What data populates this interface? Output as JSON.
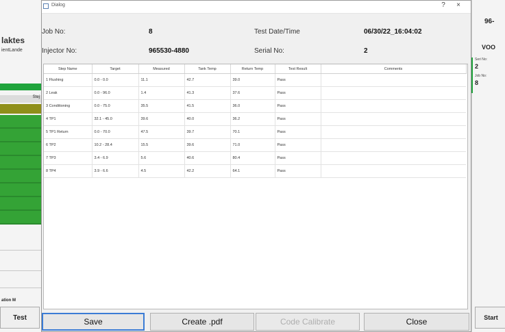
{
  "background_left": {
    "title": "laktes",
    "subtitle": "ientLande",
    "header_cell": "Stej",
    "status_label": "ation M",
    "test_button": "Test"
  },
  "background_right": {
    "number": "96-",
    "voo_label": "VOO",
    "field1_label": "Seri No:",
    "field1_value": "2",
    "field2_label": "Job No:",
    "field2_value": "8",
    "start_button": "Start"
  },
  "dialog": {
    "window_title": "Dialog",
    "job_no_label": "Job No:",
    "job_no_value": "8",
    "test_datetime_label": "Test Date/Time",
    "test_datetime_value": "06/30/22_16:04:02",
    "injector_no_label": "Injector No:",
    "injector_no_value": "965530-4880",
    "serial_no_label": "Serial No:",
    "serial_no_value": "2"
  },
  "table": {
    "headers": [
      "Step Name",
      "Target",
      "Measured",
      "Tank Temp",
      "Return Temp",
      "Test Result",
      "Comments"
    ],
    "rows": [
      [
        "1 Flushing",
        "0.0 - 0.0",
        "11.1",
        "42.7",
        "39.0",
        "Pass",
        ""
      ],
      [
        "2 Leak",
        "0.0 - 96.0",
        "1.4",
        "41.3",
        "37.6",
        "Pass",
        ""
      ],
      [
        "3 Conditioning",
        "0.0 - 75.0",
        "35.5",
        "41.5",
        "36.0",
        "Pass",
        ""
      ],
      [
        "4 TP1",
        "32.1 - 45.0",
        "39.6",
        "40.0",
        "36.2",
        "Pass",
        ""
      ],
      [
        "5 TP1 Return",
        "0.0 - 70.0",
        "47.5",
        "39.7",
        "70.1",
        "Pass",
        ""
      ],
      [
        "6 TP2",
        "10.2 - 28.4",
        "15.5",
        "39.6",
        "71.0",
        "Pass",
        ""
      ],
      [
        "7 TP3",
        "3.4 - 6.9",
        "5.6",
        "40.6",
        "80.4",
        "Pass",
        ""
      ],
      [
        "8 TP4",
        "3.9 - 6.6",
        "4.5",
        "42.2",
        "64.1",
        "Pass",
        ""
      ]
    ]
  },
  "buttons": {
    "save": "Save",
    "create_pdf": "Create .pdf",
    "code_calibrate": "Code Calibrate",
    "close": "Close"
  },
  "colors": {
    "green": "#1fa33b",
    "olive": "#8f8f1a",
    "accent": "#3a7bd5"
  }
}
